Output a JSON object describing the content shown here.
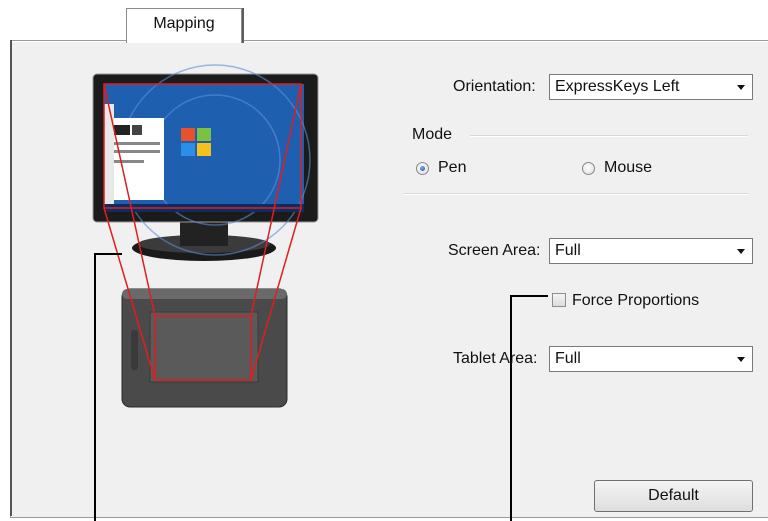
{
  "tabs": {
    "mapping": "Mapping"
  },
  "orientation": {
    "label": "Orientation:",
    "value": "ExpressKeys Left"
  },
  "mode": {
    "label": "Mode",
    "pen": "Pen",
    "mouse": "Mouse",
    "selected": "Pen"
  },
  "screen_area": {
    "label": "Screen Area:",
    "value": "Full"
  },
  "force_proportions": {
    "label": "Force Proportions",
    "checked": false
  },
  "tablet_area": {
    "label": "Tablet Area:",
    "value": "Full"
  },
  "default_button": "Default",
  "icons": {
    "dropdown": "chevron-down-icon"
  },
  "colors": {
    "mapping_lines": "#e01e1e",
    "desktop_blue": "#1f5fb0"
  }
}
